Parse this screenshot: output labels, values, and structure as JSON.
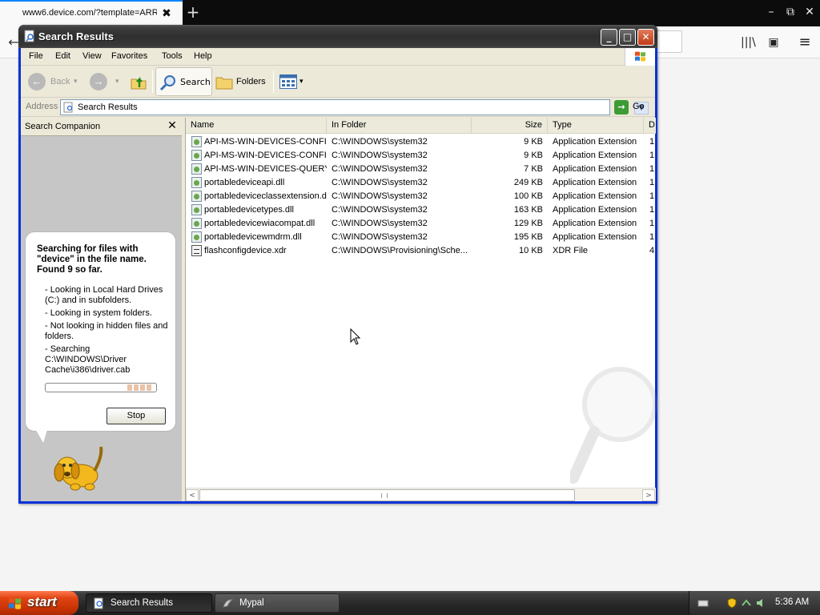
{
  "browser": {
    "tab_title": "www6.device.com/?template=ARR",
    "tab_close_glyph": "✖",
    "new_tab_glyph": "+",
    "minimize_glyph": "–",
    "restore_glyph": "⧉",
    "close_glyph": "✕",
    "back_glyph": "←",
    "library_glyph": "|||\\",
    "sidebar_glyph": "▣",
    "menu_glyph": "≡"
  },
  "window": {
    "title": "Search Results",
    "minimize_glyph": "_",
    "maximize_glyph": "□",
    "close_glyph": "✕"
  },
  "menu": [
    "File",
    "Edit",
    "View",
    "Favorites",
    "Tools",
    "Help"
  ],
  "toolbar": {
    "back_label": "Back",
    "back_glyph": "←",
    "forward_glyph": "→",
    "dropdown_glyph": "▾",
    "search_label": "Search",
    "folders_label": "Folders"
  },
  "address": {
    "label": "Address",
    "value": "Search Results",
    "dropdown_glyph": "▼",
    "go_label": "Go",
    "go_glyph": "→"
  },
  "companion": {
    "title": "Search Companion",
    "close_glyph": "✕",
    "heading": "Searching for files with \"device\" in the file name. Found 9 so far.",
    "bullets": [
      "- Looking in Local Hard Drives (C:) and in subfolders.",
      "- Looking in system folders.",
      "- Not looking in hidden files and folders.",
      "- Searching C:\\WINDOWS\\Driver Cache\\i386\\driver.cab"
    ],
    "progress": 0.22,
    "stop_label": "Stop"
  },
  "results": {
    "columns": [
      "Name",
      "In Folder",
      "Size",
      "Type",
      "D"
    ],
    "rows": [
      {
        "name": "API-MS-WIN-DEVICES-CONFI...",
        "folder": "C:\\WINDOWS\\system32",
        "size": "9 KB",
        "type": "Application Extension",
        "extra": "1",
        "icon": "dll"
      },
      {
        "name": "API-MS-WIN-DEVICES-CONFI...",
        "folder": "C:\\WINDOWS\\system32",
        "size": "9 KB",
        "type": "Application Extension",
        "extra": "1",
        "icon": "dll"
      },
      {
        "name": "API-MS-WIN-DEVICES-QUERY...",
        "folder": "C:\\WINDOWS\\system32",
        "size": "7 KB",
        "type": "Application Extension",
        "extra": "1",
        "icon": "dll"
      },
      {
        "name": "portabledeviceapi.dll",
        "folder": "C:\\WINDOWS\\system32",
        "size": "249 KB",
        "type": "Application Extension",
        "extra": "1",
        "icon": "dll"
      },
      {
        "name": "portabledeviceclassextension.dll",
        "folder": "C:\\WINDOWS\\system32",
        "size": "100 KB",
        "type": "Application Extension",
        "extra": "1",
        "icon": "dll"
      },
      {
        "name": "portabledevicetypes.dll",
        "folder": "C:\\WINDOWS\\system32",
        "size": "163 KB",
        "type": "Application Extension",
        "extra": "1",
        "icon": "dll"
      },
      {
        "name": "portabledevicewiacompat.dll",
        "folder": "C:\\WINDOWS\\system32",
        "size": "129 KB",
        "type": "Application Extension",
        "extra": "1",
        "icon": "dll"
      },
      {
        "name": "portabledevicewmdrm.dll",
        "folder": "C:\\WINDOWS\\system32",
        "size": "195 KB",
        "type": "Application Extension",
        "extra": "1",
        "icon": "dll"
      },
      {
        "name": "flashconfigdevice.xdr",
        "folder": "C:\\WINDOWS\\Provisioning\\Sche...",
        "size": "10 KB",
        "type": "XDR File",
        "extra": "4",
        "icon": "xdr"
      }
    ],
    "scroll_left_glyph": "<",
    "scroll_right_glyph": ">"
  },
  "taskbar": {
    "start_label": "start",
    "tasks": [
      {
        "label": "Search Results",
        "active": true
      },
      {
        "label": "Mypal",
        "active": false
      }
    ],
    "clock": "5:36 AM"
  },
  "colors": {
    "xp_titlebar": "#3a3a3a",
    "start_button": "#d8400e",
    "firefox_accent": "#0a84ff",
    "go_green": "#3d9b35"
  }
}
